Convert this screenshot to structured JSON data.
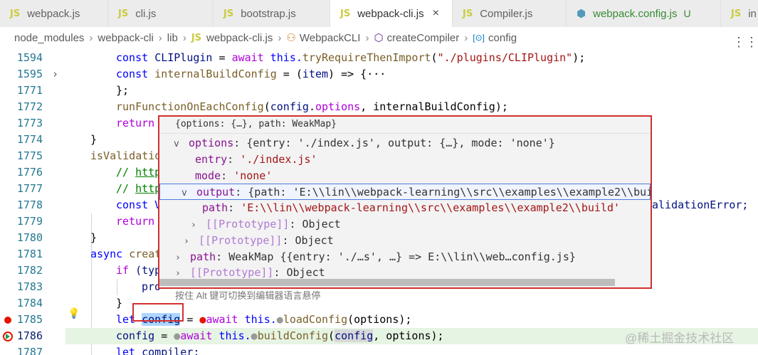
{
  "tabs": [
    {
      "icon": "JS",
      "label": "webpack.js"
    },
    {
      "icon": "JS",
      "label": "cli.js"
    },
    {
      "icon": "JS",
      "label": "bootstrap.js"
    },
    {
      "icon": "JS",
      "label": "webpack-cli.js",
      "close": "×"
    },
    {
      "icon": "JS",
      "label": "Compiler.js"
    },
    {
      "icon": "⬢",
      "label": "webpack.config.js",
      "badge": "U"
    },
    {
      "icon": "JS",
      "label": "in"
    }
  ],
  "breadcrumb": {
    "node_modules": "node_modules",
    "webpack_cli": "webpack-cli",
    "lib": "lib",
    "file_icon": "JS",
    "file": "webpack-cli.js",
    "class_icon": "⚇",
    "class": "WebpackCLI",
    "method_icon": "⬡",
    "method": "createCompiler",
    "var_icon": "[⊙]",
    "var": "config"
  },
  "editor_actions": {
    "icon": "⋮⋮"
  },
  "lines": {
    "l1594": "1594",
    "l1595": "1595",
    "l1771": "1771",
    "l1772": "1772",
    "l1773": "1773",
    "l1774": "1774",
    "l1775": "1775",
    "l1776": "1776",
    "l1777": "1777",
    "l1778": "1778",
    "l1779": "1779",
    "l1780": "1780",
    "l1781": "1781",
    "l1782": "1782",
    "l1783": "1783",
    "l1784": "1784",
    "l1785": "1785",
    "l1786": "1786",
    "l1787": "1787"
  },
  "code": {
    "c1594a": "const ",
    "c1594b": "CLIPlugin",
    "c1594c": " = ",
    "c1594d": "await ",
    "c1594e": "this.",
    "c1594f": "tryRequireThenImport",
    "c1594g": "(",
    "c1594h": "\"./plugins/CLIPlugin\"",
    "c1594i": ");",
    "c1595a": "const ",
    "c1595b": "internalBuildConfig",
    "c1595c": " = (",
    "c1595d": "item",
    "c1595e": ") => {",
    "c1595f": "···",
    "c1771": "};",
    "c1772a": "runFunctionOnEachConfig",
    "c1772b": "(",
    "c1772c": "config",
    "c1772d": ".",
    "c1772e": "options",
    "c1772f": ", internalBuildConfig);",
    "c1773": "return",
    "c1774": "}",
    "c1775": "isValidatio",
    "c1776a": "// ",
    "c1776b": "http",
    "c1777a": "// ",
    "c1777b": "http",
    "c1778a": "const V",
    "c1778b": "alidationError;",
    "c1779": "return",
    "c1780": "}",
    "c1781a": "async ",
    "c1781b": "creat",
    "c1782a": "if ",
    "c1782b": "(typ",
    "c1783": "pro",
    "c1784": "}",
    "c1785a": "let ",
    "c1785b": "config",
    "c1785c": " = ",
    "c1785d": "await ",
    "c1785e": "this.",
    "c1785f": "loadConfig",
    "c1785g": "(options);",
    "c1786a": "config",
    "c1786b": " = ",
    "c1786c": "await ",
    "c1786d": "this.",
    "c1786e": "buildConfig",
    "c1786f": "(",
    "c1786g": "config",
    "c1786h": ", options);",
    "c1787a": "let ",
    "c1787b": "compiler;"
  },
  "hover": {
    "header": "{options: {…}, path: WeakMap}",
    "options_key": "options",
    "options_val": "{entry: './index.js', output: {…}, mode: 'none'}",
    "entry_key": "entry",
    "entry_val": "'./index.js'",
    "mode_key": "mode",
    "mode_val": "'none'",
    "output_key": "output",
    "output_val": "{path: 'E:\\\\lin\\\\webpack-learning\\\\src\\\\examples\\\\example2\\\\buil",
    "path_key": "path",
    "path_val": "'E:\\\\lin\\\\webpack-learning\\\\src\\\\examples\\\\example2\\\\build'",
    "proto1_key": "[[Prototype]]",
    "proto1_val": "Object",
    "proto2_key": "[[Prototype]]",
    "proto2_val": "Object",
    "wpath_key": "path",
    "wpath_val": "WeakMap {{entry: './…s', …} => E:\\\\lin\\\\web…config.js}",
    "proto3_key": "[[Prototype]]",
    "proto3_val": "Object",
    "footer": "按住 Alt 键可切换到编辑器语言悬停"
  },
  "watermark": "@稀土掘金技术社区",
  "colors": {
    "breakpoint": "#e51400",
    "annotation_box": "#d32f2f",
    "keyword": "#0000ff",
    "function": "#795e26",
    "string": "#a31515"
  }
}
